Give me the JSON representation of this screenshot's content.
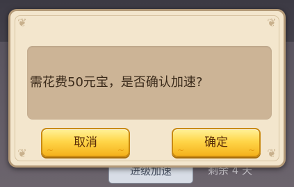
{
  "background": {
    "button_left_label": "进级加速",
    "button_right_label": "剩余 4 天"
  },
  "dialog": {
    "message": "需花费50元宝，是否确认加速?",
    "cancel_label": "取消",
    "confirm_label": "确定"
  },
  "icons": {
    "corner_ornament": "❦",
    "button_swirl": "~"
  },
  "colors": {
    "dialog_bg": "#f3e6cd",
    "message_bg": "#ccb496",
    "button_gold": "#ffd64a",
    "button_text": "#5a2c08"
  }
}
